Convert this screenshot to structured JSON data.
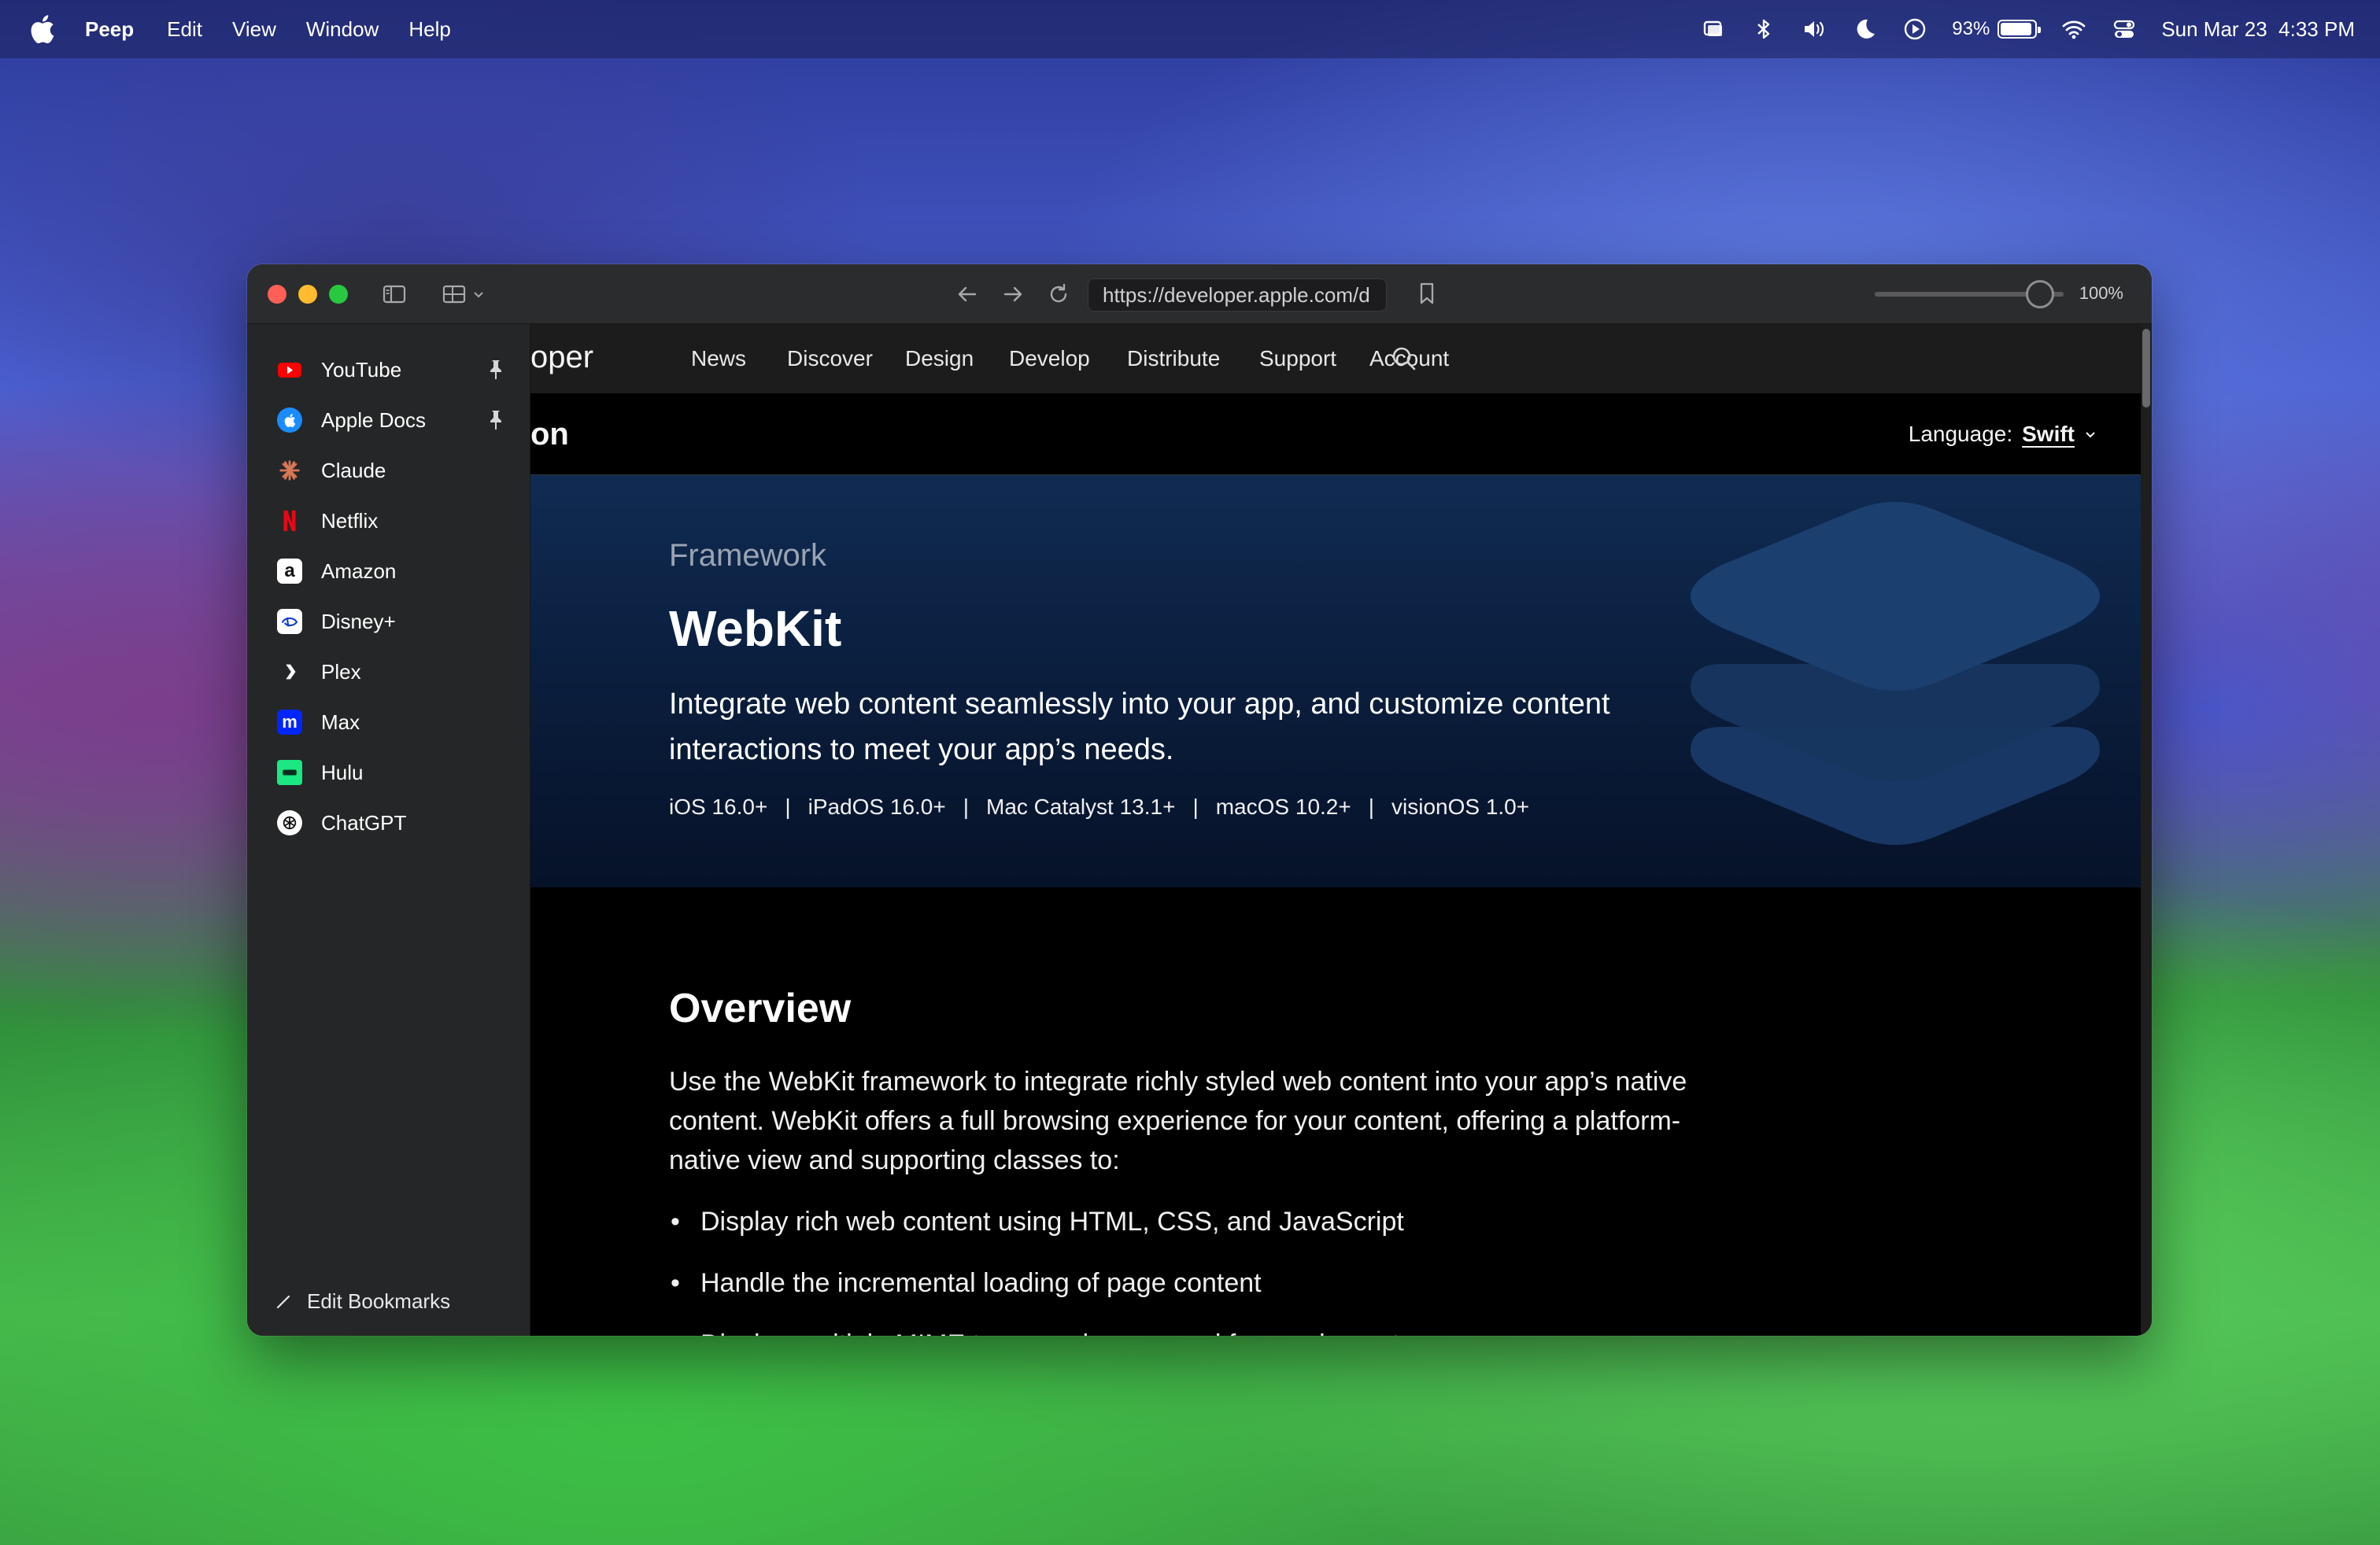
{
  "menubar": {
    "app_name": "Peep",
    "menus": [
      "Edit",
      "View",
      "Window",
      "Help"
    ],
    "battery_percent": "93%",
    "battery_level": 0.93,
    "datetime": "Sun Mar 23  4:33 PM",
    "icons": [
      "stage-manager-icon",
      "bluetooth-icon",
      "volume-icon",
      "focus-moon-icon",
      "play-icon",
      "battery-icon",
      "wifi-icon",
      "control-center-icon"
    ]
  },
  "window": {
    "url": "https://developer.apple.com/d",
    "zoom_label": "100%",
    "zoom_level": 1.0
  },
  "sidebar": {
    "bookmarks": [
      {
        "label": "YouTube",
        "pinned": true,
        "icon": "youtube-icon",
        "color": "#ff0000"
      },
      {
        "label": "Apple Docs",
        "pinned": true,
        "icon": "apple-docs-icon",
        "color": "#1a8cff"
      },
      {
        "label": "Claude",
        "pinned": false,
        "icon": "claude-icon",
        "color": "#d97757"
      },
      {
        "label": "Netflix",
        "pinned": false,
        "icon": "netflix-icon",
        "color": "#e50914"
      },
      {
        "label": "Amazon",
        "pinned": false,
        "icon": "amazon-icon",
        "color": "#ffffff"
      },
      {
        "label": "Disney+",
        "pinned": false,
        "icon": "disney-plus-icon",
        "color": "#ffffff"
      },
      {
        "label": "Plex",
        "pinned": false,
        "icon": "plex-icon",
        "color": "#e5a00d"
      },
      {
        "label": "Max",
        "pinned": false,
        "icon": "max-icon",
        "color": "#0026ff"
      },
      {
        "label": "Hulu",
        "pinned": false,
        "icon": "hulu-icon",
        "color": "#1ce783"
      },
      {
        "label": "ChatGPT",
        "pinned": false,
        "icon": "chatgpt-icon",
        "color": "#ffffff"
      }
    ],
    "edit_label": "Edit Bookmarks"
  },
  "site": {
    "brand_fragment": "oper",
    "nav": [
      "News",
      "Discover",
      "Design",
      "Develop",
      "Distribute",
      "Support",
      "Account"
    ],
    "subbar_title_fragment": "on",
    "language_label": "Language:",
    "language_value": "Swift",
    "hero": {
      "eyebrow": "Framework",
      "title": "WebKit",
      "abstract": "Integrate web content seamlessly into your app, and customize content interactions to meet your app’s needs.",
      "platforms": [
        "iOS 16.0+",
        "iPadOS 16.0+",
        "Mac Catalyst 13.1+",
        "macOS 10.2+",
        "visionOS 1.0+"
      ]
    },
    "overview": {
      "heading": "Overview",
      "paragraph": "Use the WebKit framework to integrate richly styled web content into your app’s native content. WebKit offers a full browsing experience for your content, offering a platform-native view and supporting classes to:",
      "bullets": [
        "Display rich web content using HTML, CSS, and JavaScript",
        "Handle the incremental loading of page content",
        "Display multiple MIME types and compound frame elements"
      ]
    }
  },
  "colors": {
    "accent_blue": "#2b6ad0",
    "hero_top": "#102b52",
    "hero_bottom": "#061228"
  }
}
